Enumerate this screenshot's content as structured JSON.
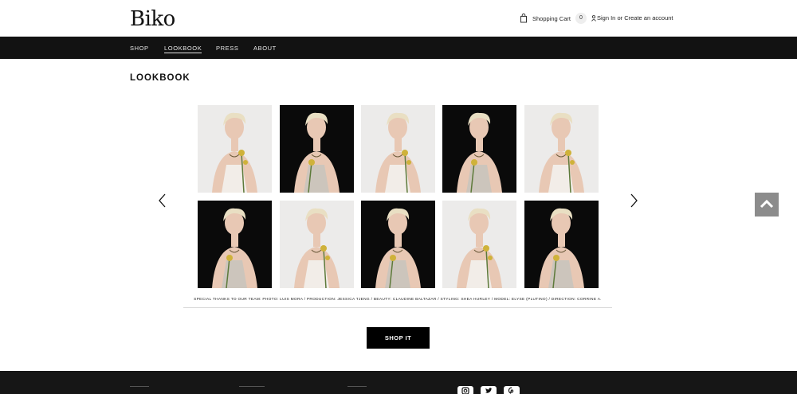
{
  "header": {
    "logo": "Biko",
    "cart_label": "Shopping Cart",
    "cart_count": "0",
    "sign_in": "Sign In",
    "or": " or ",
    "create_account": "Create an account"
  },
  "nav": {
    "items": [
      {
        "label": "SHOP"
      },
      {
        "label": "LOOKBOOK"
      },
      {
        "label": "PRESS"
      },
      {
        "label": "ABOUT"
      }
    ],
    "active": "LOOKBOOK"
  },
  "page_title": "LOOKBOOK",
  "gallery": {
    "credits": "SPECIAL THANKS TO OUR TEAM:  PHOTO: LUIS MORA  /  PRODUCTION: JESSICA TJENG  /  BEAUTY: CLAUDINE BALTAZAR  /  STYLING: SHEA HURLEY  /  MODEL: ELYSE (PLUTINO)  /  DIRECTION: CORRINE A.",
    "photos": [
      {
        "background": "light"
      },
      {
        "background": "dark"
      },
      {
        "background": "light"
      },
      {
        "background": "dark"
      },
      {
        "background": "light"
      },
      {
        "background": "dark"
      },
      {
        "background": "light"
      },
      {
        "background": "dark"
      },
      {
        "background": "light"
      },
      {
        "background": "dark"
      }
    ],
    "prev_icon": "chevron-left-icon",
    "next_icon": "chevron-right-icon"
  },
  "shop_button": "SHOP IT",
  "back_to_top_icon": "chevron-up-icon",
  "footer": {
    "social_icons": [
      "instagram-icon",
      "twitter-icon",
      "pinterest-icon"
    ]
  },
  "colors": {
    "nav_bg": "#121212",
    "footer_bg": "#161616",
    "button_bg": "#000000",
    "back_to_top_bg": "#8c8c8c"
  }
}
